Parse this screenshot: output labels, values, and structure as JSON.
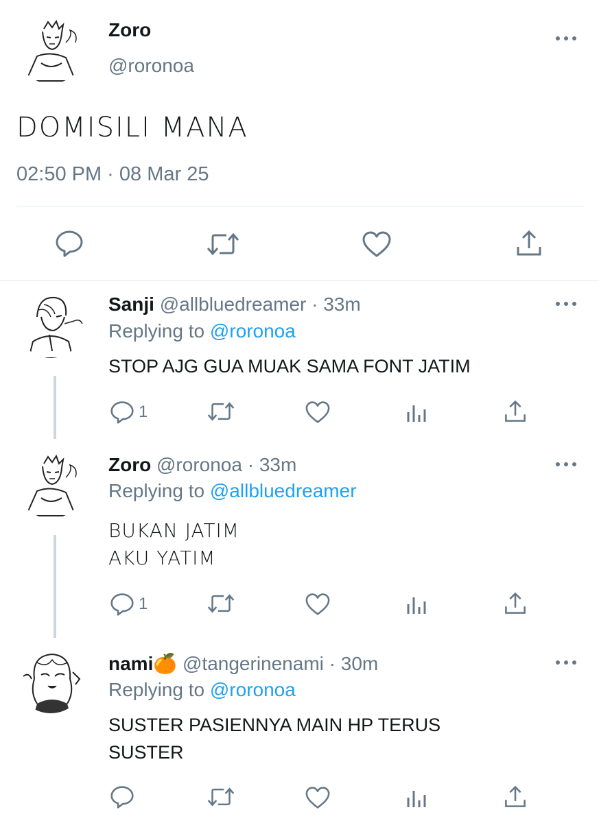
{
  "main_tweet": {
    "name": "Zoro",
    "handle": "@roronoa",
    "text": "DOMISILI MANA",
    "timestamp": "02:50 PM · 08 Mar 25",
    "actions": [
      "reply-icon",
      "retweet-icon",
      "like-icon",
      "share-icon"
    ]
  },
  "replies": [
    {
      "name": "Sanji",
      "handle": "@allbluedreamer",
      "time": "· 33m",
      "replying_prefix": "Replying to ",
      "replying_to": "@roronoa",
      "lines": [
        "STOP AJG GUA MUAK SAMA FONT JATIM"
      ],
      "reply_count": "1"
    },
    {
      "name": "Zoro",
      "handle": "@roronoa",
      "time": "· 33m",
      "replying_prefix": "Replying to ",
      "replying_to": "@allbluedreamer",
      "lines": [
        "BUKAN JATIM",
        "AKU YATIM"
      ],
      "reply_count": "1"
    },
    {
      "name": "nami🍊",
      "handle": "@tangerinenami",
      "time": "· 30m",
      "replying_prefix": "Replying to ",
      "replying_to": "@roronoa",
      "lines": [
        "SUSTER PASIENNYA MAIN HP TERUS",
        "SUSTER"
      ],
      "reply_count": ""
    }
  ],
  "colors": {
    "text": "#14171a",
    "secondary": "#657786",
    "link": "#1da1f2",
    "divider": "#e1e8ed"
  }
}
